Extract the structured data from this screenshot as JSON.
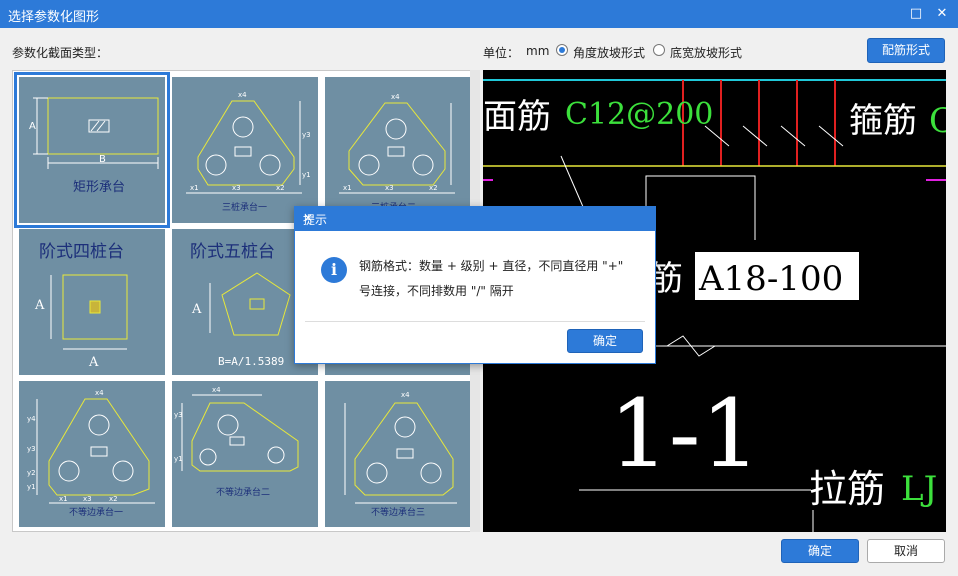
{
  "window": {
    "title": "选择参数化图形",
    "maximize_icon": "maximize-icon",
    "close_icon": "close-icon"
  },
  "toolbar": {
    "section_label": "参数化截面类型：",
    "unit_label": "单位：",
    "unit_value": "mm",
    "radio_angle": "角度放坡形式",
    "radio_width": "底宽放坡形式",
    "selected_radio": "角度放坡形式",
    "rebar_button": "配筋形式"
  },
  "tiles": [
    {
      "name": "矩形承台",
      "a": "A",
      "b": "B"
    },
    {
      "name": "三桩承台一"
    },
    {
      "name": "三桩承台二"
    },
    {
      "name": "阶式四桩台",
      "a": "A",
      "b": "A"
    },
    {
      "name": "阶式五桩台",
      "a": "A",
      "formula": "B=A/1.5389"
    },
    {
      "name": ""
    },
    {
      "name": "不等边承台一"
    },
    {
      "name": "不等边承台二"
    },
    {
      "name": "不等边承台三"
    }
  ],
  "dims": {
    "x1": "x1",
    "x2": "x2",
    "x3": "x3",
    "x4": "x4",
    "y1": "y1",
    "y2": "y2",
    "y3": "y3",
    "y4": "y4"
  },
  "preview": {
    "top_rebar": "面筋",
    "top_rebar_spec": "C12@200",
    "stirrup": "箍筋",
    "stirrup_spec": "C",
    "side_rebar": "筋",
    "side_rebar_spec": "A18-100",
    "section": "1-1",
    "tie_rebar": "拉筋",
    "tie_rebar_spec": "LJ"
  },
  "dialog": {
    "title": "提示",
    "message": "钢筋格式：数量 + 级别 + 直径，不同直径用 \"+\" 号连接，不同排数用 \"/\" 隔开",
    "ok": "确定"
  },
  "footer": {
    "ok": "确定",
    "cancel": "取消"
  },
  "colors": {
    "accent": "#2d7ad8",
    "tile_bg": "#6f8fa3",
    "shape_line": "#e8e83a",
    "preview_bg": "#000000",
    "cad_green": "#3ce03c",
    "cad_red": "#e02020"
  }
}
